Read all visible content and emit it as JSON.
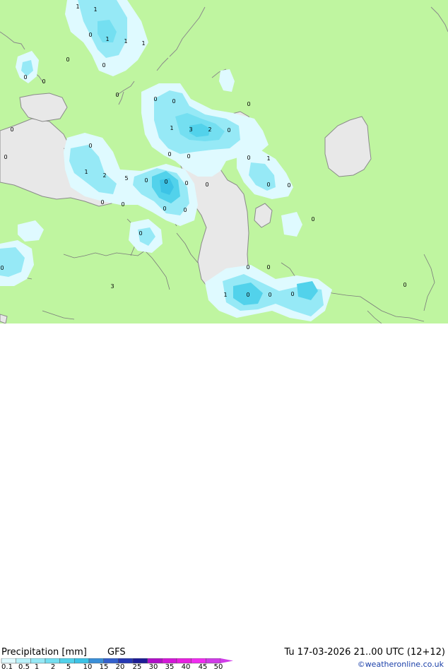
{
  "map": {
    "colors": {
      "land": "#bff5a0",
      "sea": "#e8e8e8",
      "border": "#7a7a7a",
      "coast": "#8a8a8a"
    },
    "point_values": [
      "1",
      "1",
      "1",
      "0",
      "1",
      "1",
      "0",
      "0",
      "0",
      "0",
      "0",
      "0",
      "0",
      "0",
      "1",
      "3",
      "2",
      "0",
      "0",
      "0",
      "0",
      "0",
      "0",
      "1",
      "0",
      "1",
      "2",
      "5",
      "0",
      "0",
      "0",
      "0",
      "0",
      "0",
      "0",
      "0",
      "0",
      "0",
      "0",
      "0",
      "0",
      "0",
      "0",
      "3",
      "0",
      "1",
      "0",
      "0",
      "0"
    ]
  },
  "footer": {
    "title": "Precipitation [mm]",
    "model": "GFS",
    "datetime": "Tu 17-03-2026 21..00 UTC (12+12)",
    "credit": "©weatheronline.co.uk"
  },
  "legend": {
    "labels": [
      "0.1",
      "0.5",
      "1",
      "2",
      "5",
      "10",
      "15",
      "20",
      "25",
      "30",
      "35",
      "40",
      "45",
      "50"
    ],
    "colors": [
      "#dffaff",
      "#b8f2fb",
      "#96e9f6",
      "#74dff1",
      "#52d2eb",
      "#3cc3e6",
      "#3a8fd8",
      "#3360cc",
      "#2638b4",
      "#1d1d96",
      "#b010c8",
      "#d418d8",
      "#e820e0",
      "#f02cf0",
      "#d03ce8"
    ]
  }
}
